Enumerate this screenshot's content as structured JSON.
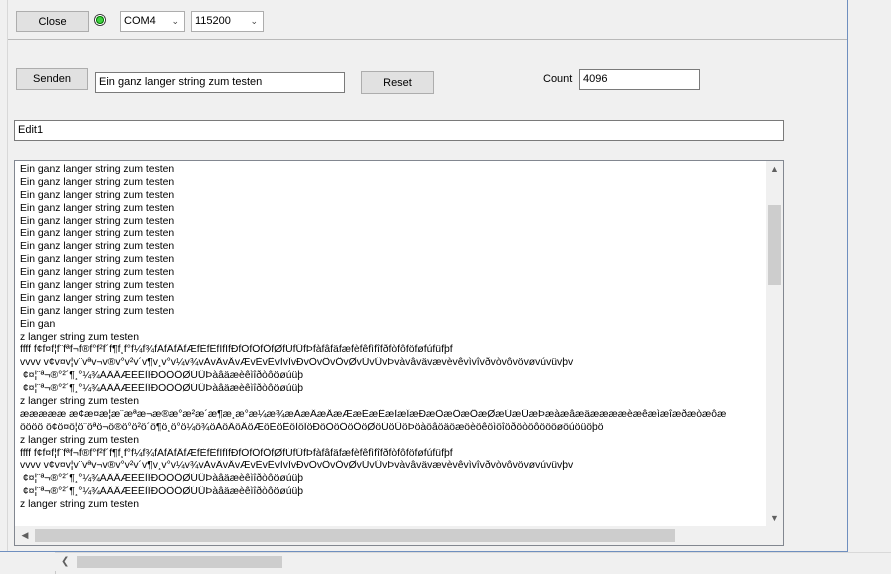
{
  "toolbar": {
    "close_label": "Close",
    "port_value": "COM4",
    "baud_value": "115200"
  },
  "send": {
    "send_label": "Senden",
    "input_value": "Ein ganz langer string zum testen",
    "reset_label": "Reset",
    "count_label": "Count",
    "count_value": "4096"
  },
  "edit1_value": "Edit1",
  "memo": {
    "lines": [
      "Ein ganz langer string zum testen",
      "Ein ganz langer string zum testen",
      "Ein ganz langer string zum testen",
      "Ein ganz langer string zum testen",
      "Ein ganz langer string zum testen",
      "Ein ganz langer string zum testen",
      "Ein ganz langer string zum testen",
      "Ein ganz langer string zum testen",
      "Ein ganz langer string zum testen",
      "Ein ganz langer string zum testen",
      "Ein ganz langer string zum testen",
      "Ein ganz langer string zum testen",
      "Ein gan",
      "z langer string zum testen",
      "ffff f¢f¤f¦f¨fªf¬f®f°f²f´f¶f¸f°f¼f¾fÀfÂfÄfÆfÈfÊfÌfÎfÐfÒfÔfÖfØfÚfÜfÞfàfâfäfæfèfêfìfîfðfòfôföføfúfüfþf",
      "vvvv v¢v¤v¦v¨vªv¬v®v°v²v´v¶v¸v°v¼v¾vÀvÂvÄvÆvÈvÊvÌvÎvÐvÒvÔvÖvØvÚvÜvÞvàvâvävævèvêvìvîvðvòvôvövøvúvüvþv",
      " ¢¤¦¨ª¬®°²´¶¸°¼¾ÀÂÄÆÈÊÌÎÐÒÔÖØÚÜÞàâäæèêìîðòôöøúüþ",
      " ¢¤¦¨ª¬®°²´¶¸°¼¾ÀÂÄÆÈÊÌÎÐÒÔÖØÚÜÞàâäæèêìîðòôöøúüþ",
      "z langer string zum testen",
      "æææææ æ¢æ¤æ¦æ¨æªæ¬æ®æ°æ²æ´æ¶æ¸æ°æ¼æ¾æÀæÂæÄæÆæÈæÊæÌæÎæÐæÒæÔæÖæØæÚæÜæÞæàæâæäææææèæêæìæîæðæòæôæ",
      "öööö ö¢ö¤ö¦ö¨öªö¬ö®ö°ö²ö´ö¶ö¸ö°ö¼ö¾öÀöÂöÄöÆöÈöÊöÌöÎöÐöÒöÔöÖöØöÚöÜöÞöàöâöäöæöèöêöìöîöðöòöôöööøöúöüöþö",
      "z langer string zum testen",
      "ffff f¢f¤f¦f¨fªf¬f®f°f²f´f¶f¸f°f¼f¾fÀfÂfÄfÆfÈfÊfÌfÎfÐfÒfÔfÖfØfÚfÜfÞfàfâfäfæfèfêfìfîfðfòfôföføfúfüfþf",
      "vvvv v¢v¤v¦v¨vªv¬v®v°v²v´v¶v¸v°v¼v¾vÀvÂvÄvÆvÈvÊvÌvÎvÐvÒvÔvÖvØvÚvÜvÞvàvâvävævèvêvìvîvðvòvôvövøvúvüvþv",
      " ¢¤¦¨ª¬®°²´¶¸°¼¾ÀÂÄÆÈÊÌÎÐÒÔÖØÚÜÞàâäæèêìîðòôöøúüþ",
      " ¢¤¦¨ª¬®°²´¶¸°¼¾ÀÂÄÆÈÊÌÎÐÒÔÖØÚÜÞàâäæèêìîðòôöøúüþ",
      "z langer string zum testen"
    ]
  },
  "icons": {
    "dropdown": "chevron-down-icon",
    "led": "status-led-icon",
    "scroll_up": "scroll-up-arrow-icon",
    "scroll_down": "scroll-down-arrow-icon",
    "scroll_left": "scroll-left-arrow-icon"
  }
}
